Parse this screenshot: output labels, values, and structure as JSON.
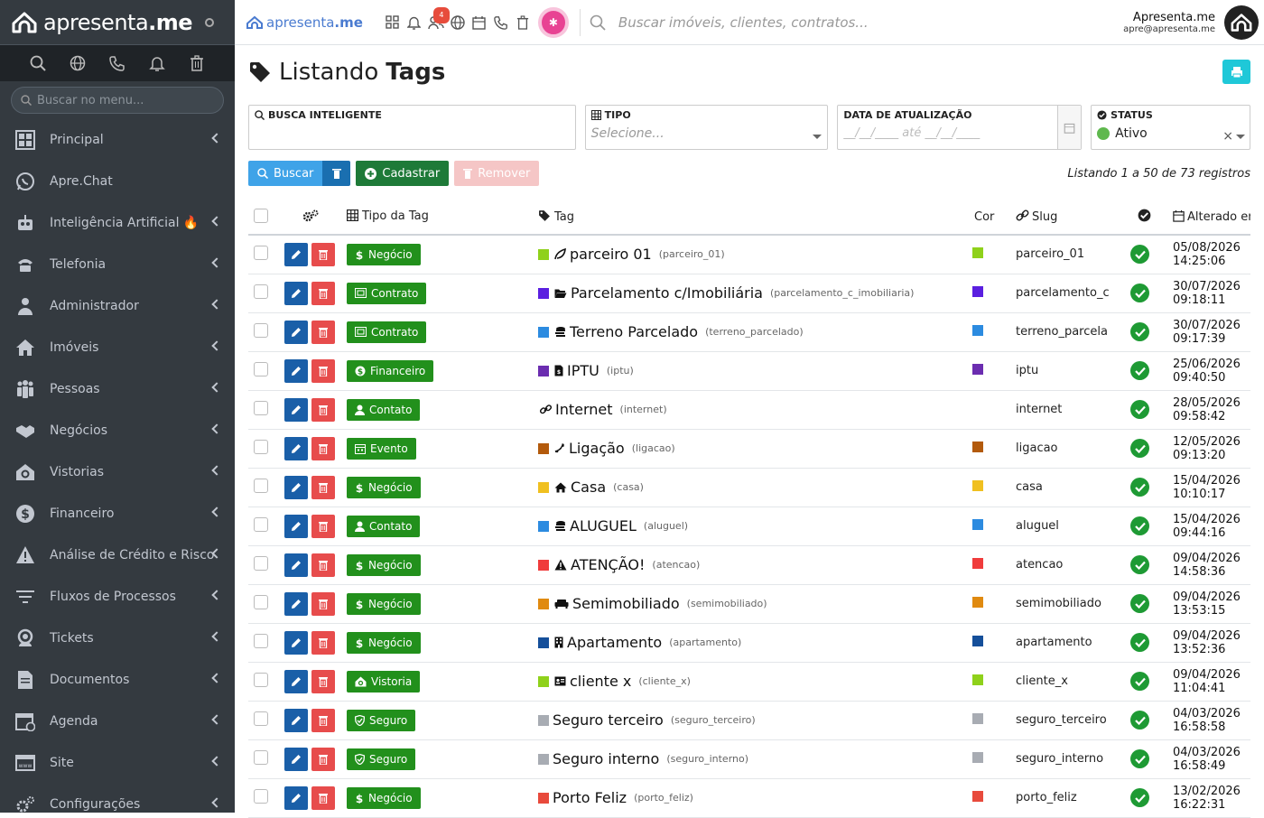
{
  "brand": {
    "name_light": "apresenta",
    "name_bold": ".me"
  },
  "sidebar": {
    "search_placeholder": "Buscar no menu...",
    "items": [
      {
        "label": "Principal",
        "icon": "dashboard-icon",
        "chevron": true
      },
      {
        "label": "Apre.Chat",
        "icon": "whatsapp-icon",
        "chevron": false
      },
      {
        "label": "Inteligência Artificial 🔥",
        "icon": "robot-icon",
        "chevron": true
      },
      {
        "label": "Telefonia",
        "icon": "phone-icon",
        "chevron": true
      },
      {
        "label": "Administrador",
        "icon": "user-admin-icon",
        "chevron": true
      },
      {
        "label": "Imóveis",
        "icon": "home-icon",
        "chevron": true
      },
      {
        "label": "Pessoas",
        "icon": "people-icon",
        "chevron": true
      },
      {
        "label": "Negócios",
        "icon": "handshake-icon",
        "chevron": true
      },
      {
        "label": "Vistorias",
        "icon": "house-search-icon",
        "chevron": true
      },
      {
        "label": "Financeiro",
        "icon": "dollar-icon",
        "chevron": true
      },
      {
        "label": "Análise de Crédito e Risco",
        "icon": "warning-icon",
        "chevron": true
      },
      {
        "label": "Fluxos de Processos",
        "icon": "filter-icon",
        "chevron": true
      },
      {
        "label": "Tickets",
        "icon": "headset-icon",
        "chevron": true
      },
      {
        "label": "Documentos",
        "icon": "document-icon",
        "chevron": true
      },
      {
        "label": "Agenda",
        "icon": "calendar-icon",
        "chevron": true
      },
      {
        "label": "Site",
        "icon": "browser-icon",
        "chevron": true
      },
      {
        "label": "Configurações",
        "icon": "gears-icon",
        "chevron": true
      }
    ]
  },
  "topbar": {
    "logo_light": "apresenta",
    "logo_bold": "me",
    "notif_badge": "4",
    "search_placeholder": "Buscar imóveis, clientes, contratos...",
    "user_name": "Apresenta.me",
    "user_email": "apre@apresenta.me"
  },
  "page": {
    "title_light": "Listando",
    "title_bold": "Tags"
  },
  "filters": {
    "smart_search_label": "BUSCA INTELIGENTE",
    "smart_search_value": "",
    "tipo_label": "TIPO",
    "tipo_placeholder": "Selecione...",
    "date_label": "DATA DE ATUALIZAÇÃO",
    "date_placeholder": "__/__/____  até  __/__/____",
    "status_label": "STATUS",
    "status_value": "Ativo"
  },
  "actions": {
    "search": "Buscar",
    "create": "Cadastrar",
    "remove": "Remover",
    "listing": "Listando 1 a 50 de 73 registros"
  },
  "table": {
    "headers": {
      "tipo": "Tipo da Tag",
      "tag": "Tag",
      "cor": "Cor",
      "slug": "Slug",
      "alterado": "Alterado em"
    },
    "rows": [
      {
        "tipo": "Negócio",
        "tipo_icon": "dollar-icon",
        "swatch": "#8fd11b",
        "tag_icon": "leaf",
        "name": "parceiro 01",
        "slug_small": "(parceiro_01)",
        "color": "#8fd11b",
        "slug": "parceiro_01",
        "date": "05/08/2026",
        "time": "14:25:06"
      },
      {
        "tipo": "Contrato",
        "tipo_icon": "contract-icon",
        "swatch": "#5a1fe0",
        "tag_icon": "folder",
        "name": "Parcelamento c/Imobiliária",
        "slug_small": "(parcelamento_c_imobiliaria)",
        "color": "#5a1fe0",
        "slug": "parcelamento_c",
        "date": "30/07/2026",
        "time": "09:18:11"
      },
      {
        "tipo": "Contrato",
        "tipo_icon": "contract-icon",
        "swatch": "#2c8be0",
        "tag_icon": "coins",
        "name": "Terreno Parcelado",
        "slug_small": "(terreno_parcelado)",
        "color": "#2c8be0",
        "slug": "terreno_parcela",
        "date": "30/07/2026",
        "time": "09:17:39"
      },
      {
        "tipo": "Financeiro",
        "tipo_icon": "money-icon",
        "swatch": "#6b2db0",
        "tag_icon": "file",
        "name": "IPTU",
        "slug_small": "(iptu)",
        "color": "#6b2db0",
        "slug": "iptu",
        "date": "25/06/2026",
        "time": "09:40:50"
      },
      {
        "tipo": "Contato",
        "tipo_icon": "user-icon",
        "swatch": "",
        "tag_icon": "link",
        "name": "Internet",
        "slug_small": "(internet)",
        "color": "",
        "slug": "internet",
        "date": "28/05/2026",
        "time": "09:58:42"
      },
      {
        "tipo": "Evento",
        "tipo_icon": "calendar-icon",
        "swatch": "#b35a0c",
        "tag_icon": "phone",
        "name": "Ligação",
        "slug_small": "(ligacao)",
        "color": "#b35a0c",
        "slug": "ligacao",
        "date": "12/05/2026",
        "time": "09:13:20"
      },
      {
        "tipo": "Negócio",
        "tipo_icon": "dollar-icon",
        "swatch": "#f0c020",
        "tag_icon": "house",
        "name": "Casa",
        "slug_small": "(casa)",
        "color": "#f0c020",
        "slug": "casa",
        "date": "15/04/2026",
        "time": "10:10:17"
      },
      {
        "tipo": "Contato",
        "tipo_icon": "user-icon",
        "swatch": "#2c8be0",
        "tag_icon": "coins",
        "name": "ALUGUEL",
        "slug_small": "(aluguel)",
        "color": "#2c8be0",
        "slug": "aluguel",
        "date": "15/04/2026",
        "time": "09:44:16"
      },
      {
        "tipo": "Negócio",
        "tipo_icon": "dollar-icon",
        "swatch": "#f03c3c",
        "tag_icon": "warning",
        "name": "ATENÇÃO!",
        "slug_small": "(atencao)",
        "color": "#f03c3c",
        "slug": "atencao",
        "date": "09/04/2026",
        "time": "14:58:36"
      },
      {
        "tipo": "Negócio",
        "tipo_icon": "dollar-icon",
        "swatch": "#e08a10",
        "tag_icon": "couch",
        "name": "Semimobiliado",
        "slug_small": "(semimobiliado)",
        "color": "#e08a10",
        "slug": "semimobiliado",
        "date": "09/04/2026",
        "time": "13:53:15"
      },
      {
        "tipo": "Negócio",
        "tipo_icon": "dollar-icon",
        "swatch": "#154f9a",
        "tag_icon": "building",
        "name": "Apartamento",
        "slug_small": "(apartamento)",
        "color": "#154f9a",
        "slug": "apartamento",
        "date": "09/04/2026",
        "time": "13:52:36"
      },
      {
        "tipo": "Vistoria",
        "tipo_icon": "house-search-icon",
        "swatch": "#8fd11b",
        "tag_icon": "card",
        "name": "cliente x",
        "slug_small": "(cliente_x)",
        "color": "#8fd11b",
        "slug": "cliente_x",
        "date": "09/04/2026",
        "time": "11:04:41"
      },
      {
        "tipo": "Seguro",
        "tipo_icon": "shield-icon",
        "swatch": "#a8acb3",
        "tag_icon": "",
        "name": "Seguro terceiro",
        "slug_small": "(seguro_terceiro)",
        "color": "#a8acb3",
        "slug": "seguro_terceiro",
        "date": "04/03/2026",
        "time": "16:58:58"
      },
      {
        "tipo": "Seguro",
        "tipo_icon": "shield-icon",
        "swatch": "#a8acb3",
        "tag_icon": "",
        "name": "Seguro interno",
        "slug_small": "(seguro_interno)",
        "color": "#a8acb3",
        "slug": "seguro_interno",
        "date": "04/03/2026",
        "time": "16:58:49"
      },
      {
        "tipo": "Negócio",
        "tipo_icon": "dollar-icon",
        "swatch": "#e84a3c",
        "tag_icon": "",
        "name": "Porto Feliz",
        "slug_small": "(porto_feliz)",
        "color": "#e84a3c",
        "slug": "porto_feliz",
        "date": "13/02/2026",
        "time": "16:22:31"
      }
    ]
  },
  "colors": {
    "sidebar_bg": "#343a40",
    "success": "#22901c",
    "primary": "#1a5fa8",
    "danger": "#e74c4c",
    "info": "#1fc8d8"
  }
}
